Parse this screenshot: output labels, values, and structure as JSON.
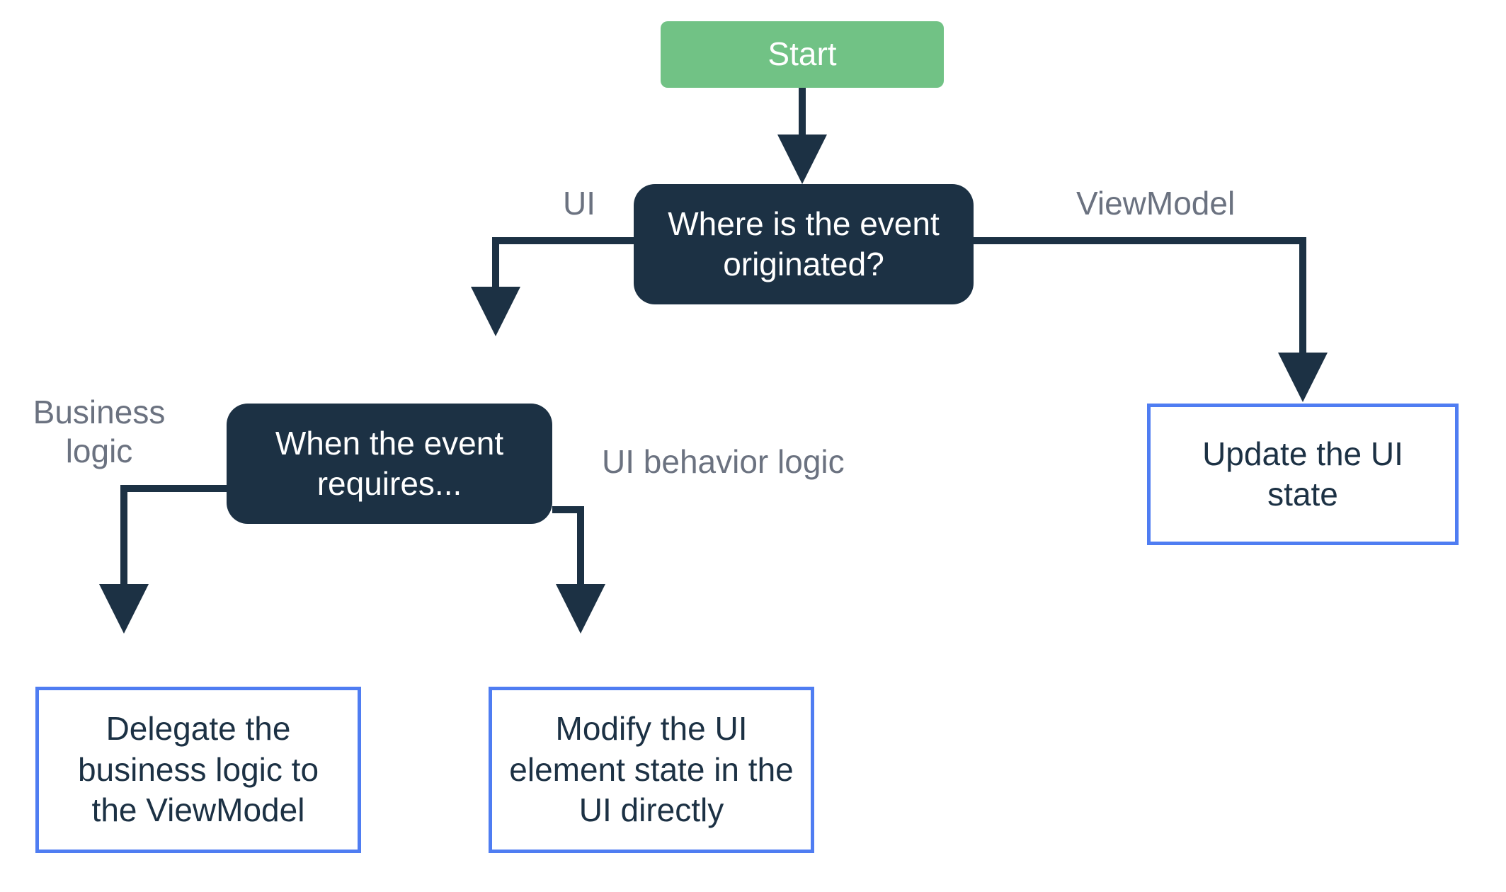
{
  "nodes": {
    "start": "Start",
    "decision1": "Where is the event originated?",
    "decision2": "When the event requires...",
    "terminal_delegate": "Delegate the business logic to the ViewModel",
    "terminal_modify": "Modify the UI element state in the UI directly",
    "terminal_update": "Update the UI state"
  },
  "edges": {
    "ui": "UI",
    "viewmodel": "ViewModel",
    "business_logic": "Business logic",
    "ui_behavior_logic": "UI behavior logic"
  },
  "colors": {
    "start_bg": "#71c285",
    "decision_bg": "#1c3144",
    "terminal_border": "#4f7df2",
    "label": "#6b7280",
    "arrow": "#1c3144"
  }
}
